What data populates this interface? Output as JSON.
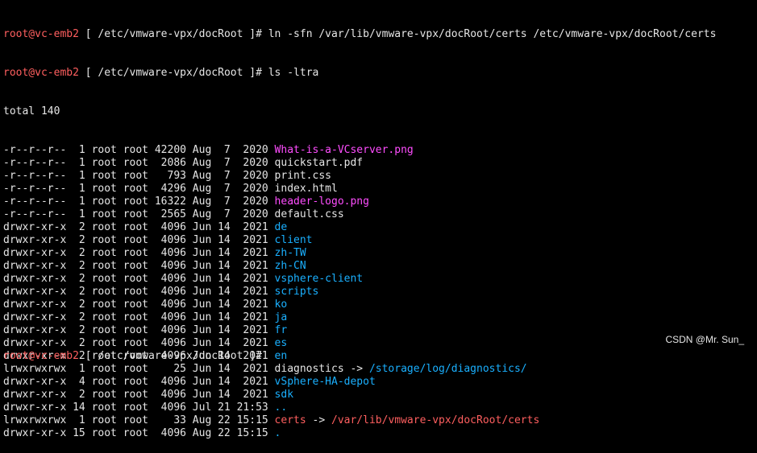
{
  "prompt": {
    "user_host": "root@vc-emb2",
    "open": " [ ",
    "path": "/etc/vmware-vpx/docRoot",
    "close": " ]# "
  },
  "commands": [
    "ln -sfn /var/lib/vmware-vpx/docRoot/certs /etc/vmware-vpx/docRoot/certs",
    "ls -ltra"
  ],
  "total_line": "total 140",
  "listing": [
    {
      "meta": "-r--r--r--  1 root root 42200 Aug  7  2020 ",
      "name": "What-is-a-VCserver.png",
      "color": "#ff4dff",
      "link": "",
      "target": "",
      "target_color": ""
    },
    {
      "meta": "-r--r--r--  1 root root  2086 Aug  7  2020 ",
      "name": "quickstart.pdf",
      "color": "#e6e6e6",
      "link": "",
      "target": "",
      "target_color": ""
    },
    {
      "meta": "-r--r--r--  1 root root   793 Aug  7  2020 ",
      "name": "print.css",
      "color": "#e6e6e6",
      "link": "",
      "target": "",
      "target_color": ""
    },
    {
      "meta": "-r--r--r--  1 root root  4296 Aug  7  2020 ",
      "name": "index.html",
      "color": "#e6e6e6",
      "link": "",
      "target": "",
      "target_color": ""
    },
    {
      "meta": "-r--r--r--  1 root root 16322 Aug  7  2020 ",
      "name": "header-logo.png",
      "color": "#ff4dff",
      "link": "",
      "target": "",
      "target_color": ""
    },
    {
      "meta": "-r--r--r--  1 root root  2565 Aug  7  2020 ",
      "name": "default.css",
      "color": "#e6e6e6",
      "link": "",
      "target": "",
      "target_color": ""
    },
    {
      "meta": "drwxr-xr-x  2 root root  4096 Jun 14  2021 ",
      "name": "de",
      "color": "#1ab0ff",
      "link": "",
      "target": "",
      "target_color": ""
    },
    {
      "meta": "drwxr-xr-x  2 root root  4096 Jun 14  2021 ",
      "name": "client",
      "color": "#1ab0ff",
      "link": "",
      "target": "",
      "target_color": ""
    },
    {
      "meta": "drwxr-xr-x  2 root root  4096 Jun 14  2021 ",
      "name": "zh-TW",
      "color": "#1ab0ff",
      "link": "",
      "target": "",
      "target_color": ""
    },
    {
      "meta": "drwxr-xr-x  2 root root  4096 Jun 14  2021 ",
      "name": "zh-CN",
      "color": "#1ab0ff",
      "link": "",
      "target": "",
      "target_color": ""
    },
    {
      "meta": "drwxr-xr-x  2 root root  4096 Jun 14  2021 ",
      "name": "vsphere-client",
      "color": "#1ab0ff",
      "link": "",
      "target": "",
      "target_color": ""
    },
    {
      "meta": "drwxr-xr-x  2 root root  4096 Jun 14  2021 ",
      "name": "scripts",
      "color": "#1ab0ff",
      "link": "",
      "target": "",
      "target_color": ""
    },
    {
      "meta": "drwxr-xr-x  2 root root  4096 Jun 14  2021 ",
      "name": "ko",
      "color": "#1ab0ff",
      "link": "",
      "target": "",
      "target_color": ""
    },
    {
      "meta": "drwxr-xr-x  2 root root  4096 Jun 14  2021 ",
      "name": "ja",
      "color": "#1ab0ff",
      "link": "",
      "target": "",
      "target_color": ""
    },
    {
      "meta": "drwxr-xr-x  2 root root  4096 Jun 14  2021 ",
      "name": "fr",
      "color": "#1ab0ff",
      "link": "",
      "target": "",
      "target_color": ""
    },
    {
      "meta": "drwxr-xr-x  2 root root  4096 Jun 14  2021 ",
      "name": "es",
      "color": "#1ab0ff",
      "link": "",
      "target": "",
      "target_color": ""
    },
    {
      "meta": "drwxr-xr-x  2 root root  4096 Jun 14  2021 ",
      "name": "en",
      "color": "#1ab0ff",
      "link": "",
      "target": "",
      "target_color": ""
    },
    {
      "meta": "lrwxrwxrwx  1 root root    25 Jun 14  2021 ",
      "name": "diagnostics",
      "color": "#e6e6e6",
      "link": " -> ",
      "target": "/storage/log/diagnostics/",
      "target_color": "#1ab0ff"
    },
    {
      "meta": "drwxr-xr-x  4 root root  4096 Jun 14  2021 ",
      "name": "vSphere-HA-depot",
      "color": "#1ab0ff",
      "link": "",
      "target": "",
      "target_color": ""
    },
    {
      "meta": "drwxr-xr-x  2 root root  4096 Jun 14  2021 ",
      "name": "sdk",
      "color": "#1ab0ff",
      "link": "",
      "target": "",
      "target_color": ""
    },
    {
      "meta": "drwxr-xr-x 14 root root  4096 Jul 21 21:53 ",
      "name": "..",
      "color": "#1ab0ff",
      "link": "",
      "target": "",
      "target_color": ""
    },
    {
      "meta": "lrwxrwxrwx  1 root root    33 Aug 22 15:15 ",
      "name": "certs",
      "color": "#ff5f5f",
      "link": " -> ",
      "target": "/var/lib/vmware-vpx/docRoot/certs",
      "target_color": "#ff5f5f"
    },
    {
      "meta": "drwxr-xr-x 15 root root  4096 Aug 22 15:15 ",
      "name": ".",
      "color": "#1ab0ff",
      "link": "",
      "target": "",
      "target_color": ""
    }
  ],
  "watermark": "CSDN @Mr. Sun_"
}
